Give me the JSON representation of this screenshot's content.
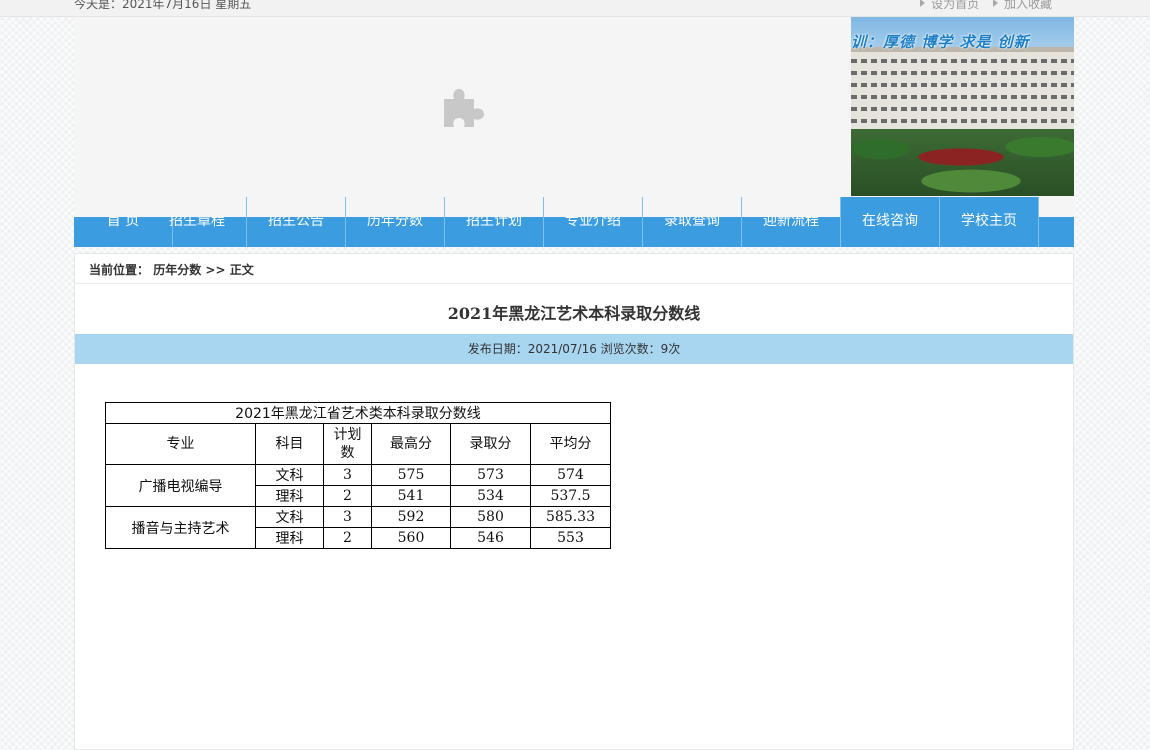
{
  "topbar": {
    "date_text": "今天是：2021年7月16日 星期五",
    "links": [
      "设为首页",
      "加入收藏"
    ]
  },
  "header": {
    "banner_motto": "训：厚德 博学 求是 创新"
  },
  "nav": {
    "items": [
      "首 页",
      "招生章程",
      "招生公告",
      "历年分数",
      "招生计划",
      "专业介绍",
      "录取查询",
      "迎新流程",
      "在线咨询",
      "学校主页"
    ]
  },
  "breadcrumb": {
    "prefix": "当前位置：",
    "section": "历年分数",
    "separator": ">>",
    "current": "正文"
  },
  "article": {
    "title": "2021年黑龙江艺术本科录取分数线",
    "meta": "发布日期：2021/07/16 浏览次数：9次"
  },
  "table": {
    "caption": "2021年黑龙江省艺术类本科录取分数线",
    "headers": [
      "专业",
      "科目",
      "计划数",
      "最高分",
      "录取分",
      "平均分"
    ],
    "header_plan_line1": "计划",
    "header_plan_line2": "数",
    "groups": [
      {
        "major": "广播电视编导",
        "rows": [
          {
            "subject": "文科",
            "plan": "3",
            "max": "575",
            "admit": "573",
            "avg": "574"
          },
          {
            "subject": "理科",
            "plan": "2",
            "max": "541",
            "admit": "534",
            "avg": "537.5"
          }
        ]
      },
      {
        "major": "播音与主持艺术",
        "rows": [
          {
            "subject": "文科",
            "plan": "3",
            "max": "592",
            "admit": "580",
            "avg": "585.33"
          },
          {
            "subject": "理科",
            "plan": "2",
            "max": "560",
            "admit": "546",
            "avg": "553"
          }
        ]
      }
    ]
  },
  "colors": {
    "nav_blue": "#3c9ce0",
    "meta_bar": "#a8d5f0"
  },
  "icons": [
    "puzzle-plugin-icon",
    "triangle-bullet-icon"
  ]
}
